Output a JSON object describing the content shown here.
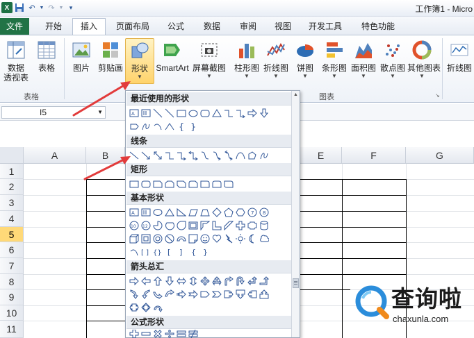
{
  "window": {
    "title": "工作簿1 - Micro"
  },
  "ribbon_tabs": [
    {
      "label": "文件"
    },
    {
      "label": "开始"
    },
    {
      "label": "插入"
    },
    {
      "label": "页面布局"
    },
    {
      "label": "公式"
    },
    {
      "label": "数据"
    },
    {
      "label": "审阅"
    },
    {
      "label": "视图"
    },
    {
      "label": "开发工具"
    },
    {
      "label": "特色功能"
    }
  ],
  "ribbon": {
    "buttons": [
      {
        "label": "数据",
        "label2": "透视表"
      },
      {
        "label": "表格"
      },
      {
        "label": "图片"
      },
      {
        "label": "剪贴画"
      },
      {
        "label": "形状"
      },
      {
        "label": "SmartArt"
      },
      {
        "label": "屏幕截图"
      },
      {
        "label": "柱形图"
      },
      {
        "label": "折线图"
      },
      {
        "label": "饼图"
      },
      {
        "label": "条形图"
      },
      {
        "label": "面积图"
      },
      {
        "label": "散点图"
      },
      {
        "label": "其他图表"
      },
      {
        "label": "折线图"
      }
    ],
    "groups": [
      {
        "label": "表格"
      },
      {
        "label": "图表"
      }
    ]
  },
  "formula_bar": {
    "name_box": "I5"
  },
  "grid": {
    "columns": [
      "A",
      "B",
      "E",
      "F",
      "G"
    ],
    "rows": [
      "1",
      "2",
      "3",
      "4",
      "5",
      "6",
      "7",
      "8",
      "9",
      "10",
      "11"
    ],
    "selected_row": "5"
  },
  "shapes_menu": {
    "sections": [
      {
        "title": "最近使用的形状"
      },
      {
        "title": "线条"
      },
      {
        "title": "矩形"
      },
      {
        "title": "基本形状"
      },
      {
        "title": "箭头总汇"
      },
      {
        "title": "公式形状"
      }
    ]
  },
  "watermark": {
    "brand": "查询啦",
    "url": "chaxunla.com"
  },
  "colors": {
    "file_tab": "#217346",
    "selected_button": "#ffd36b",
    "annotation_arrow": "#e23b3b",
    "shape_blue": "#2f5597"
  }
}
